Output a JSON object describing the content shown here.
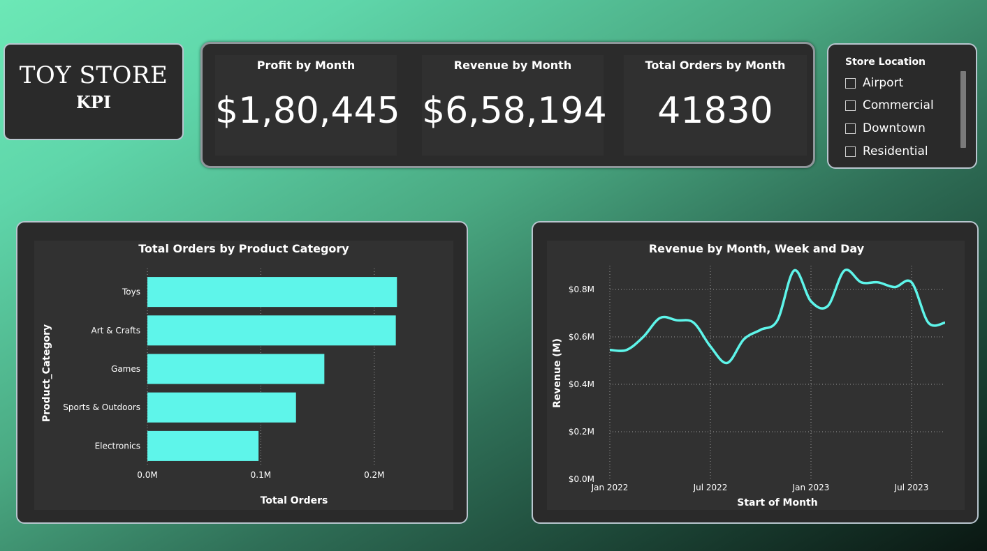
{
  "logo": {
    "line1": "TOY STORE",
    "line2": "KPI"
  },
  "kpis": [
    {
      "title": "Profit by Month",
      "value": "$1,80,445"
    },
    {
      "title": "Revenue by Month",
      "value": "$6,58,194"
    },
    {
      "title": "Total Orders by Month",
      "value": "41830"
    }
  ],
  "slicer": {
    "title": "Store Location",
    "items": [
      "Airport",
      "Commercial",
      "Downtown",
      "Residential"
    ]
  },
  "chart_data": [
    {
      "type": "bar",
      "orientation": "horizontal",
      "title": "Total Orders by Product Category",
      "xlabel": "Total Orders",
      "ylabel": "Product_Category",
      "categories": [
        "Toys",
        "Art & Crafts",
        "Games",
        "Sports & Outdoors",
        "Electronics"
      ],
      "values": [
        0.22,
        0.219,
        0.156,
        0.131,
        0.098
      ],
      "unit": "M",
      "xticks": [
        "0.0M",
        "0.1M",
        "0.2M"
      ],
      "xlim": [
        0,
        0.25
      ],
      "color": "#5ef5ea",
      "grid": "vertical dotted"
    },
    {
      "type": "line",
      "title": "Revenue by Month, Week and Day",
      "xlabel": "Start of Month",
      "ylabel": "Revenue (M)",
      "x": [
        "2022-01",
        "2022-02",
        "2022-03",
        "2022-04",
        "2022-05",
        "2022-06",
        "2022-07",
        "2022-08",
        "2022-09",
        "2022-10",
        "2022-11",
        "2022-12",
        "2023-01",
        "2023-02",
        "2023-03",
        "2023-04",
        "2023-05",
        "2023-06",
        "2023-07",
        "2023-08",
        "2023-09"
      ],
      "series": [
        {
          "values": [
            0.545,
            0.545,
            0.6,
            0.68,
            0.67,
            0.66,
            0.56,
            0.49,
            0.59,
            0.63,
            0.67,
            0.88,
            0.75,
            0.73,
            0.88,
            0.83,
            0.83,
            0.81,
            0.83,
            0.66,
            0.66
          ]
        }
      ],
      "xticks": [
        "Jan 2022",
        "Jul 2022",
        "Jan 2023",
        "Jul 2023"
      ],
      "yticks": [
        "$0.0M",
        "$0.2M",
        "$0.4M",
        "$0.6M",
        "$0.8M"
      ],
      "ylim": [
        0,
        0.9
      ],
      "color": "#5ef5ea",
      "grid": "dotted"
    }
  ]
}
